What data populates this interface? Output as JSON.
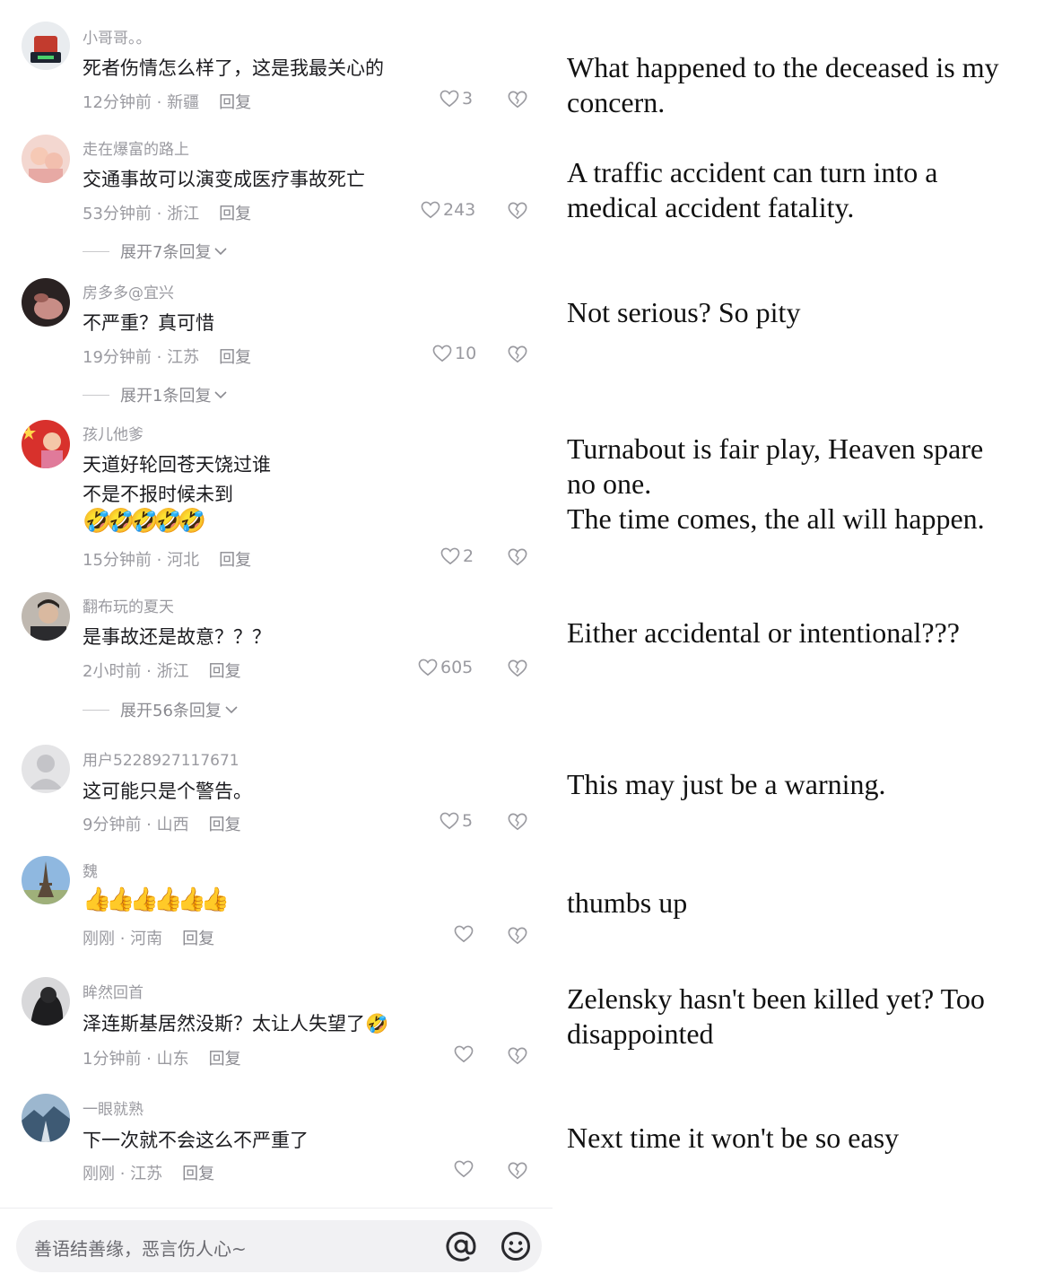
{
  "comments": [
    {
      "user": "小哥哥。。",
      "text": "死者伤情怎么样了，这是我最关心的",
      "time": "12分钟前",
      "loc": "新疆",
      "likes": "3",
      "translation": [
        "What happened to the deceased is my",
        "concern."
      ]
    },
    {
      "user": "走在爆富的路上",
      "text": "交通事故可以演变成医疗事故死亡",
      "time": "53分钟前",
      "loc": "浙江",
      "likes": "243",
      "expand": "展开7条回复",
      "translation": [
        "A traffic accident can turn into a",
        "medical accident fatality."
      ]
    },
    {
      "user": "房多多@宜兴",
      "text": "不严重？真可惜",
      "time": "19分钟前",
      "loc": "江苏",
      "likes": "10",
      "expand": "展开1条回复",
      "translation": [
        "Not serious? So pity"
      ]
    },
    {
      "user": "孩儿他爹",
      "text": "天道好轮回苍天饶过谁",
      "text2": "不是不报时候未到",
      "emojis": "🤣🤣🤣🤣🤣",
      "time": "15分钟前",
      "loc": "河北",
      "likes": "2",
      "translation": [
        "Turnabout is fair play, Heaven spare",
        "no one.",
        "The time comes, the all will happen."
      ]
    },
    {
      "user": "翻布玩的夏天",
      "text": "是事故还是故意？？？",
      "time": "2小时前",
      "loc": "浙江",
      "likes": "605",
      "expand": "展开56条回复",
      "translation": [
        "Either accidental or intentional???"
      ]
    },
    {
      "user": "用户5228927117671",
      "text": "这可能只是个警告。",
      "time": "9分钟前",
      "loc": "山西",
      "likes": "5",
      "translation": [
        "This may just be a warning."
      ]
    },
    {
      "user": "魏",
      "emojis": "👍👍👍👍👍👍",
      "time": "刚刚",
      "loc": "河南",
      "likes": "",
      "translation": [
        "thumbs up"
      ]
    },
    {
      "user": "眸然回首",
      "text": "泽连斯基居然没斯？太让人失望了🤣",
      "time": "1分钟前",
      "loc": "山东",
      "likes": "",
      "translation": [
        "Zelensky hasn't been killed yet? Too",
        "disappointed"
      ]
    },
    {
      "user": "一眼就熟",
      "text": "下一次就不会这么不严重了",
      "time": "刚刚",
      "loc": "江苏",
      "likes": "",
      "translation": [
        "Next time it won't be so easy"
      ]
    }
  ],
  "reply_label": "回复",
  "meta_sep": " · ",
  "input": {
    "placeholder": "善语结善缘，恶言伤人心~"
  },
  "icons": {
    "at": "at-icon",
    "emoji": "emoji-icon",
    "heart": "heart-icon",
    "dislike": "broken-heart-icon"
  }
}
